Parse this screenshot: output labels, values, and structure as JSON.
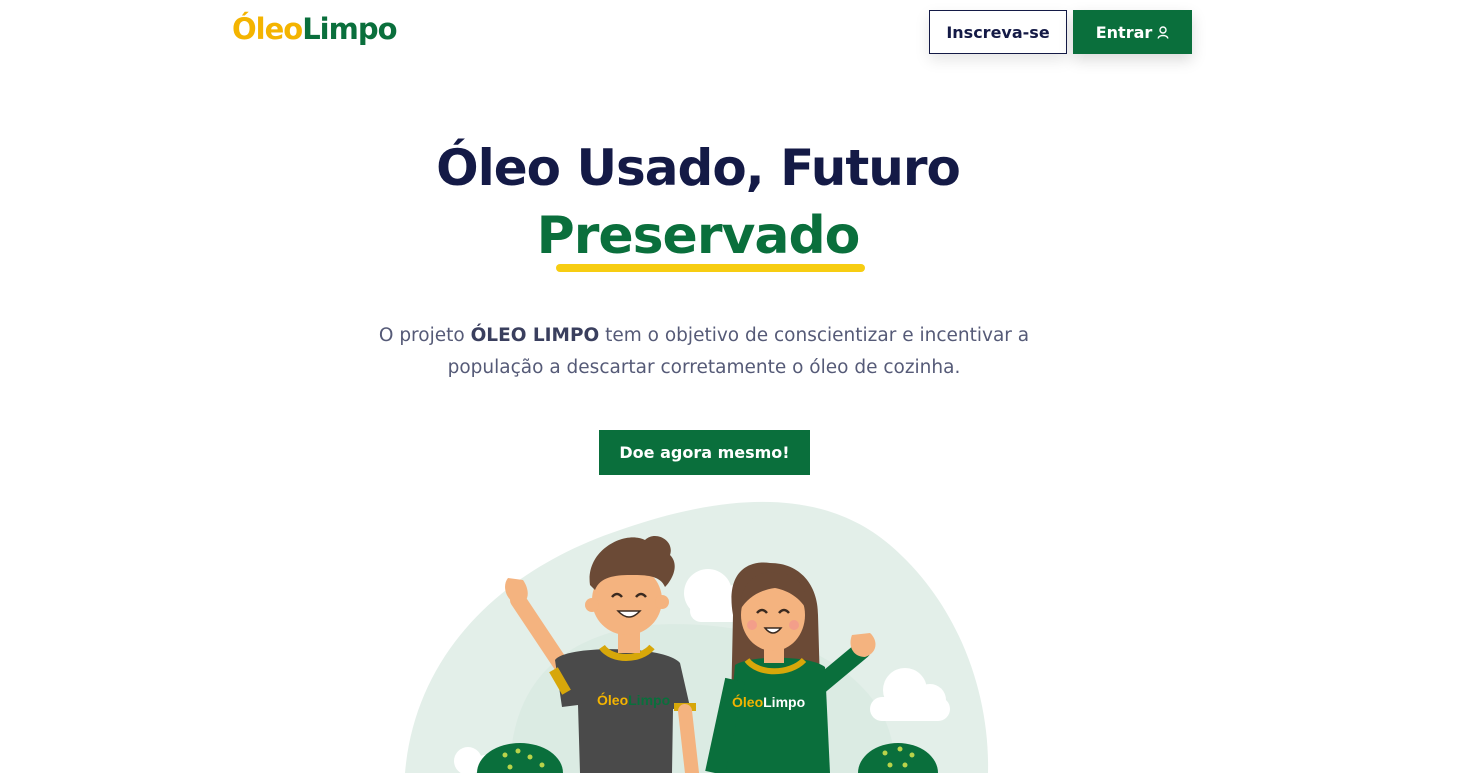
{
  "header": {
    "logo_part1": "Óleo",
    "logo_part2": "Limpo",
    "signup_label": "Inscreva-se",
    "login_label": "Entrar"
  },
  "hero": {
    "title_line1": "Óleo Usado, Futuro",
    "title_line2": "Preservado",
    "desc_prefix": "O projeto ",
    "desc_brand": "ÓLEO LIMPO",
    "desc_suffix": " tem o objetivo de conscientizar e incentivar a população a descartar corretamente o óleo de cozinha.",
    "cta_label": "Doe agora mesmo!"
  },
  "illustration": {
    "shirt_logo_part1": "Óleo",
    "shirt_logo_part2": "Limpo"
  },
  "colors": {
    "brand_green": "#0a6f3c",
    "brand_yellow": "#f4b400",
    "navy": "#141a46",
    "underline_yellow": "#f7cd12"
  },
  "icons": {
    "login": "user-icon"
  }
}
